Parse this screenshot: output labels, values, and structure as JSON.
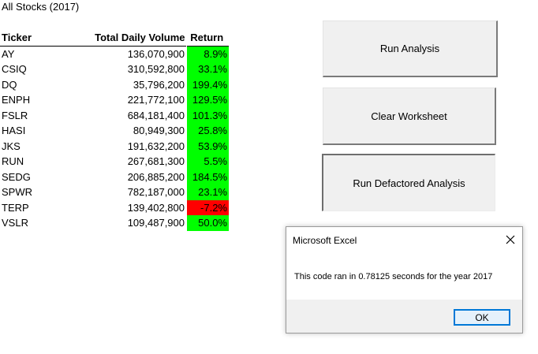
{
  "sheet": {
    "title": "All Stocks (2017)",
    "headers": {
      "ticker": "Ticker",
      "volume": "Total Daily Volume",
      "return": "Return"
    },
    "rows": [
      {
        "ticker": "AY",
        "volume": "136,070,900",
        "return": "8.9%",
        "status": "positive"
      },
      {
        "ticker": "CSIQ",
        "volume": "310,592,800",
        "return": "33.1%",
        "status": "positive"
      },
      {
        "ticker": "DQ",
        "volume": "35,796,200",
        "return": "199.4%",
        "status": "positive"
      },
      {
        "ticker": "ENPH",
        "volume": "221,772,100",
        "return": "129.5%",
        "status": "positive"
      },
      {
        "ticker": "FSLR",
        "volume": "684,181,400",
        "return": "101.3%",
        "status": "positive"
      },
      {
        "ticker": "HASI",
        "volume": "80,949,300",
        "return": "25.8%",
        "status": "positive"
      },
      {
        "ticker": "JKS",
        "volume": "191,632,200",
        "return": "53.9%",
        "status": "positive"
      },
      {
        "ticker": "RUN",
        "volume": "267,681,300",
        "return": "5.5%",
        "status": "positive"
      },
      {
        "ticker": "SEDG",
        "volume": "206,885,200",
        "return": "184.5%",
        "status": "positive"
      },
      {
        "ticker": "SPWR",
        "volume": "782,187,000",
        "return": "23.1%",
        "status": "positive"
      },
      {
        "ticker": "TERP",
        "volume": "139,402,800",
        "return": "-7.2%",
        "status": "negative"
      },
      {
        "ticker": "VSLR",
        "volume": "109,487,900",
        "return": "50.0%",
        "status": "positive"
      }
    ]
  },
  "colors": {
    "positive": "#00ff00",
    "negative": "#ff0000",
    "accent": "#0078d7"
  },
  "buttons": {
    "run_analysis": "Run Analysis",
    "clear_worksheet": "Clear Worksheet",
    "run_defactored": "Run Defactored Analysis"
  },
  "dialog": {
    "title": "Microsoft Excel",
    "message": "This code ran in 0.78125 seconds for the year 2017",
    "ok_label": "OK",
    "close_icon": "close-icon"
  }
}
